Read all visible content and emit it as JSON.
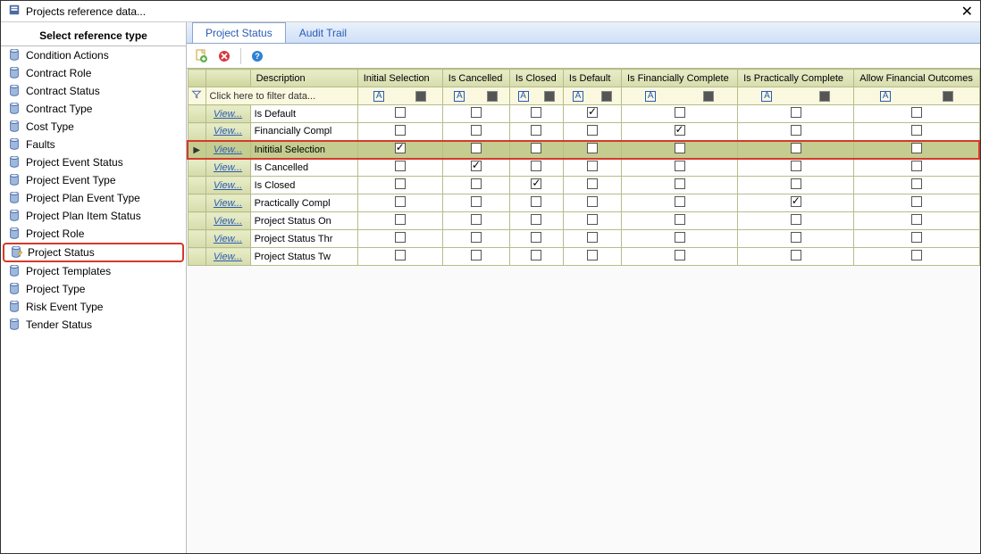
{
  "window": {
    "title": "Projects reference data..."
  },
  "sidebar": {
    "header": "Select reference type",
    "items": [
      {
        "label": "Condition Actions",
        "selected": false
      },
      {
        "label": "Contract Role",
        "selected": false
      },
      {
        "label": "Contract Status",
        "selected": false
      },
      {
        "label": "Contract Type",
        "selected": false
      },
      {
        "label": "Cost Type",
        "selected": false
      },
      {
        "label": "Faults",
        "selected": false
      },
      {
        "label": "Project Event Status",
        "selected": false
      },
      {
        "label": "Project Event Type",
        "selected": false
      },
      {
        "label": "Project Plan Event Type",
        "selected": false
      },
      {
        "label": "Project Plan Item Status",
        "selected": false
      },
      {
        "label": "Project Role",
        "selected": false
      },
      {
        "label": "Project Status",
        "selected": true
      },
      {
        "label": "Project Templates",
        "selected": false
      },
      {
        "label": "Project Type",
        "selected": false
      },
      {
        "label": "Risk Event Type",
        "selected": false
      },
      {
        "label": "Tender Status",
        "selected": false
      }
    ]
  },
  "tabs": [
    {
      "label": "Project Status",
      "active": true
    },
    {
      "label": "Audit Trail",
      "active": false
    }
  ],
  "grid": {
    "filter_hint": "Click here to filter data...",
    "view_label": "View...",
    "columns": [
      "Description",
      "Initial Selection",
      "Is Cancelled",
      "Is Closed",
      "Is Default",
      "Is Financially Complete",
      "Is Practically Complete",
      "Allow Financial Outcomes"
    ],
    "rows": [
      {
        "desc": "Is Default",
        "init": false,
        "canc": false,
        "closed": false,
        "def": true,
        "fin": false,
        "prac": false,
        "allow": false,
        "highlight": false,
        "indicator": false
      },
      {
        "desc": "Financially Compl",
        "init": false,
        "canc": false,
        "closed": false,
        "def": false,
        "fin": true,
        "prac": false,
        "allow": false,
        "highlight": false,
        "indicator": false
      },
      {
        "desc": "Inititial Selection",
        "init": true,
        "canc": false,
        "closed": false,
        "def": false,
        "fin": false,
        "prac": false,
        "allow": false,
        "highlight": true,
        "indicator": true
      },
      {
        "desc": "Is Cancelled",
        "init": false,
        "canc": true,
        "closed": false,
        "def": false,
        "fin": false,
        "prac": false,
        "allow": false,
        "highlight": false,
        "indicator": false
      },
      {
        "desc": "Is Closed",
        "init": false,
        "canc": false,
        "closed": true,
        "def": false,
        "fin": false,
        "prac": false,
        "allow": false,
        "highlight": false,
        "indicator": false
      },
      {
        "desc": "Practically Compl",
        "init": false,
        "canc": false,
        "closed": false,
        "def": false,
        "fin": false,
        "prac": true,
        "allow": false,
        "highlight": false,
        "indicator": false
      },
      {
        "desc": "Project Status On",
        "init": false,
        "canc": false,
        "closed": false,
        "def": false,
        "fin": false,
        "prac": false,
        "allow": false,
        "highlight": false,
        "indicator": false
      },
      {
        "desc": "Project Status Thr",
        "init": false,
        "canc": false,
        "closed": false,
        "def": false,
        "fin": false,
        "prac": false,
        "allow": false,
        "highlight": false,
        "indicator": false
      },
      {
        "desc": "Project Status Tw",
        "init": false,
        "canc": false,
        "closed": false,
        "def": false,
        "fin": false,
        "prac": false,
        "allow": false,
        "highlight": false,
        "indicator": false
      }
    ]
  }
}
